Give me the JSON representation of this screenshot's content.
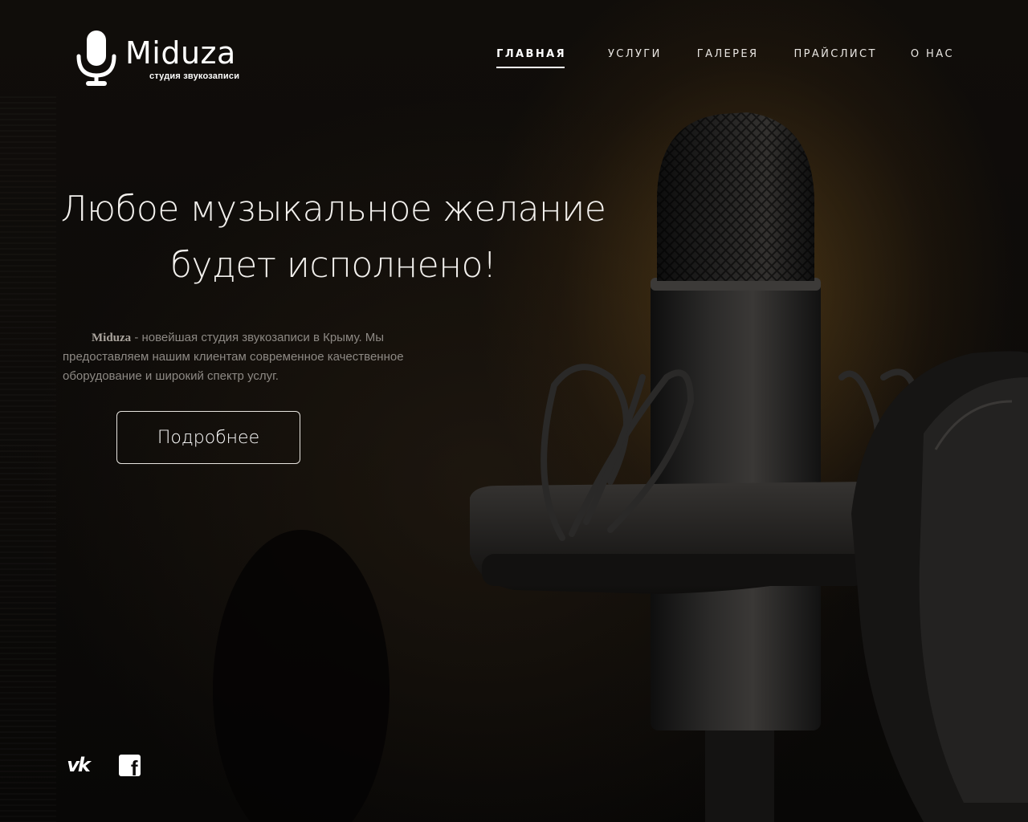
{
  "brand": {
    "name": "Miduza",
    "subtitle": "студия звукозаписи",
    "logo_icon": "microphone-icon"
  },
  "nav": {
    "items": [
      {
        "label": "ГЛАВНАЯ",
        "active": true
      },
      {
        "label": "УСЛУГИ",
        "active": false
      },
      {
        "label": "ГАЛЕРЕЯ",
        "active": false
      },
      {
        "label": "ПРАЙСЛИСТ",
        "active": false
      },
      {
        "label": "О НАС",
        "active": false
      }
    ]
  },
  "hero": {
    "title_line1": "Любое музыкальное желание",
    "title_line2": "будет исполнено!",
    "desc_brand": "Miduza",
    "desc_text": " - новейшая студия звукозаписи в Крыму. Мы предоставляем нашим клиентам современное качественное оборудование и широкий спектр услуг.",
    "button_label": "Подробнее"
  },
  "social": {
    "vk_icon": "vk-icon",
    "vk_glyph": "vk",
    "fb_icon": "facebook-icon",
    "fb_glyph": "f"
  },
  "colors": {
    "background": "#0b0908",
    "text": "#ffffff",
    "muted_text": "#8d8984",
    "accent_glow": "#785520"
  }
}
